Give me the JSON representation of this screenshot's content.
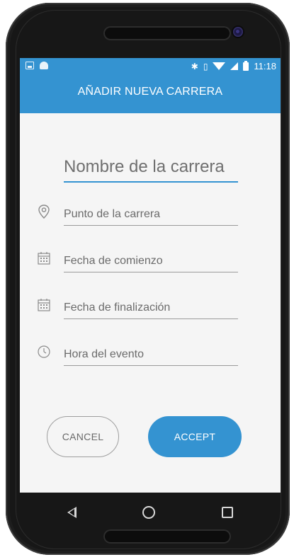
{
  "status_bar": {
    "time": "11:18",
    "icons": [
      "image-icon",
      "android-icon",
      "bluetooth-icon",
      "vibrate-icon",
      "wifi-icon",
      "signal-icon",
      "battery-icon"
    ]
  },
  "app_bar": {
    "title": "AÑADIR NUEVA CARRERA"
  },
  "form": {
    "name_placeholder": "Nombre de la carrera",
    "fields": [
      {
        "icon": "location-pin-icon",
        "placeholder": "Punto de la carrera"
      },
      {
        "icon": "calendar-icon",
        "placeholder": "Fecha de comienzo"
      },
      {
        "icon": "calendar-icon",
        "placeholder": "Fecha de finalización"
      },
      {
        "icon": "clock-icon",
        "placeholder": "Hora del evento"
      }
    ]
  },
  "buttons": {
    "cancel": "CANCEL",
    "accept": "ACCEPT"
  },
  "nav": [
    "back-icon",
    "home-icon",
    "recents-icon"
  ],
  "colors": {
    "primary": "#3493d1",
    "background": "#f5f5f5",
    "device": "#171717"
  }
}
